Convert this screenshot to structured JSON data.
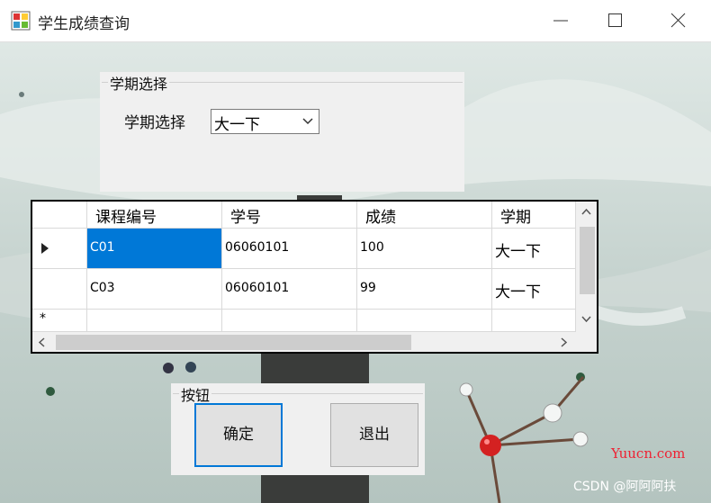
{
  "window": {
    "title": "学生成绩查询",
    "controls": [
      "minimize-icon",
      "maximize-icon",
      "close-icon"
    ]
  },
  "term_group": {
    "legend": "学期选择",
    "label": "学期选择",
    "combo_value": "大一下"
  },
  "grid": {
    "columns": [
      "课程编号",
      "学号",
      "成绩",
      "学期"
    ],
    "rows": [
      [
        "C01",
        "06060101",
        "100",
        "大一下"
      ],
      [
        "C03",
        "06060101",
        "99",
        "大一下"
      ]
    ]
  },
  "button_group": {
    "legend": "按钮",
    "ok_label": "确定",
    "exit_label": "退出"
  },
  "watermarks": {
    "site": "Yuucn.com",
    "csdn": "CSDN @阿阿阿扶"
  },
  "colors": {
    "selection": "#0078d7",
    "focus_border": "#0078d7"
  }
}
